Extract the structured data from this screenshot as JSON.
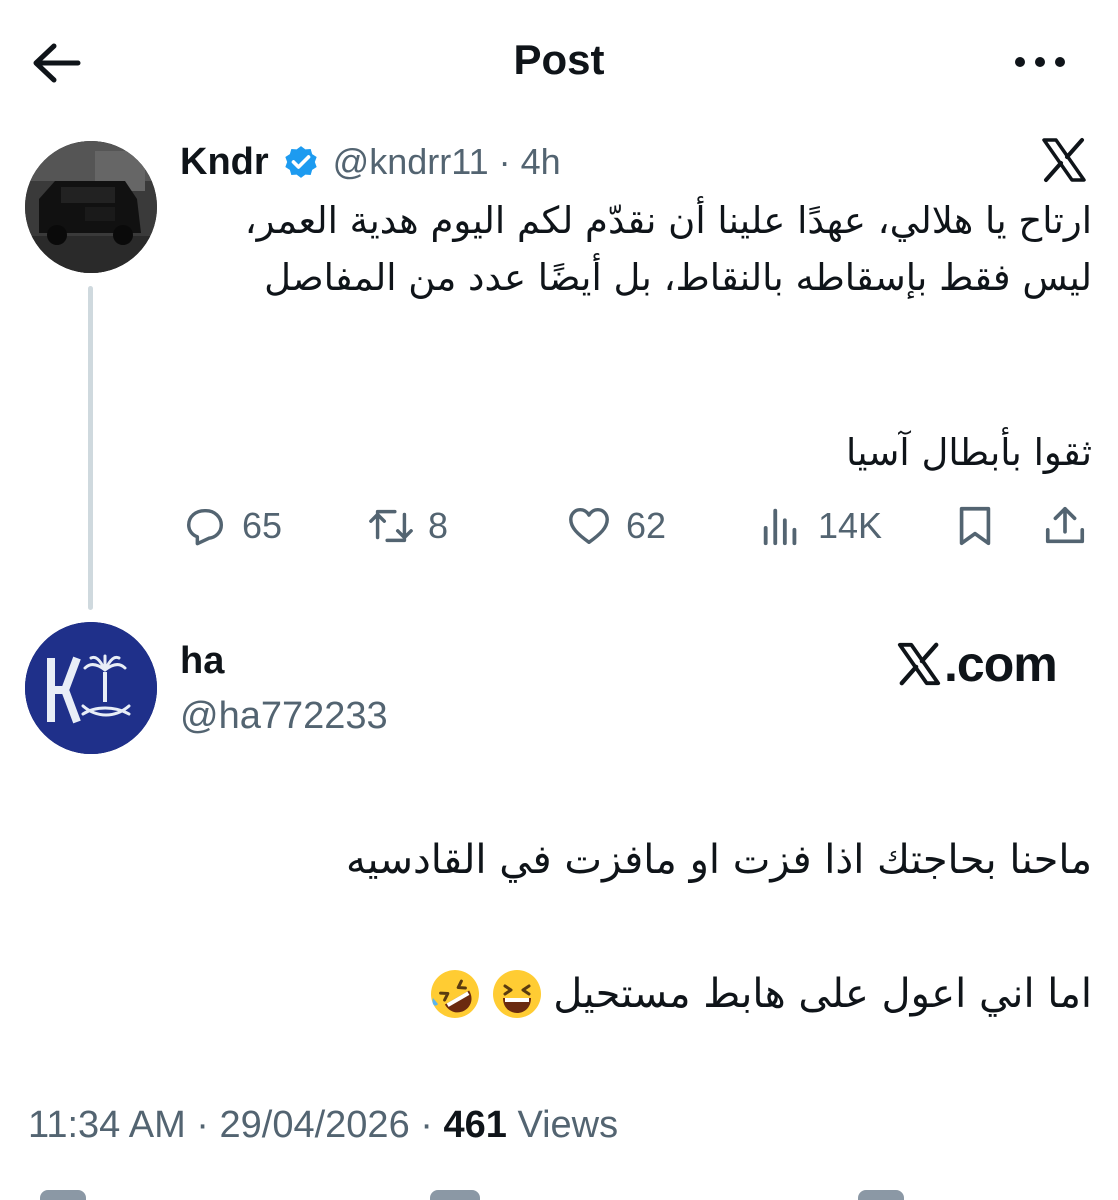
{
  "header": {
    "title": "Post"
  },
  "parent_post": {
    "display_name": "Kndr",
    "handle": "@kndrr11",
    "separator": "·",
    "time": "4h",
    "text": "ارتاح يا هلالي، عهدًا علينا أن نقدّم لكم اليوم هدية العمر، ليس فقط بإسقاطه بالنقاط، بل أيضًا عدد من المفاصل",
    "text_2": "ثقوا بأبطال آسيا",
    "stats": {
      "replies": "65",
      "reposts": "8",
      "likes": "62",
      "views": "14K"
    }
  },
  "reply_post": {
    "display_name": "ha",
    "handle": "@ha772233",
    "watermark": ".com",
    "text_1": "ماحنا بحاجتك اذا فزت او مافزت في القادسيه",
    "text_2": "اما اني اعول على هابط مستحيل"
  },
  "meta": {
    "time": "11:34 AM",
    "dot1": " · ",
    "date": "29/04/2026",
    "dot2": " · ",
    "views_count": "461",
    "views_label": " Views"
  },
  "colors": {
    "text": "#0f1419",
    "secondary": "#536471",
    "verified": "#1d9bf0",
    "thread_line": "#cfd9de"
  }
}
